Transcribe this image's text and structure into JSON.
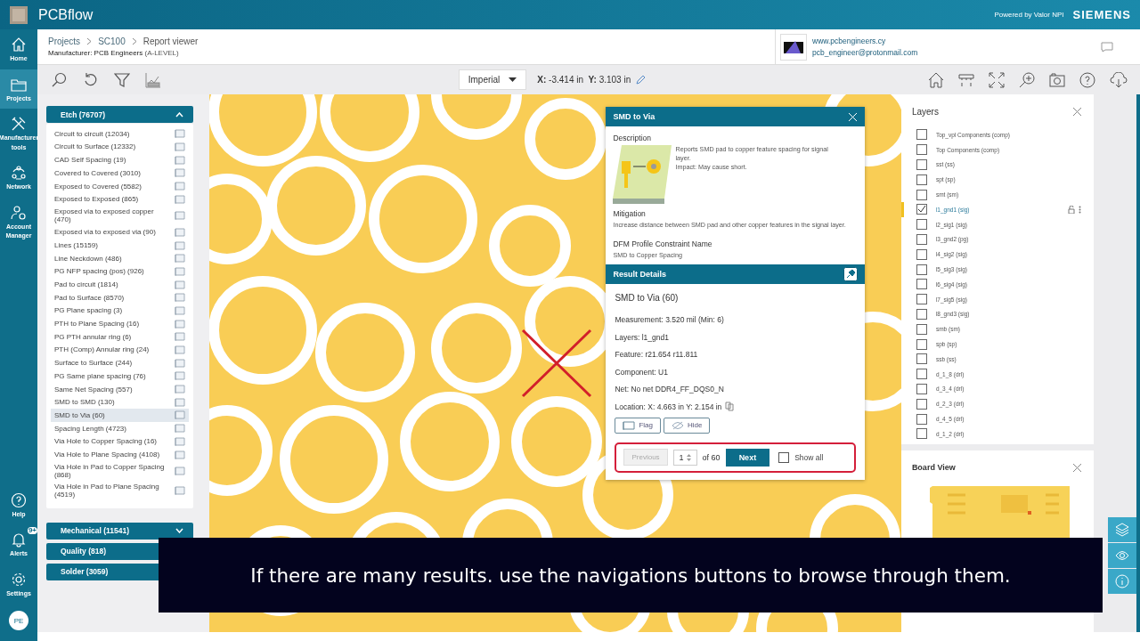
{
  "app": {
    "name": "PCBflow",
    "powered_by": "Powered by Valor NPI",
    "brand": "SIEMENS"
  },
  "nav": [
    {
      "label": "Home",
      "kind": "home",
      "selected": false
    },
    {
      "label": "Projects",
      "kind": "projects",
      "selected": true
    },
    {
      "label": "Manufacturer tools",
      "kind": "tools",
      "selected": false
    },
    {
      "label": "Network",
      "kind": "network",
      "selected": false
    },
    {
      "label": "Account Manager",
      "kind": "account",
      "selected": false
    }
  ],
  "nav_bottom": [
    {
      "label": "Help",
      "kind": "help"
    },
    {
      "label": "Alerts",
      "kind": "alerts",
      "badge": "9+"
    },
    {
      "label": "Settings",
      "kind": "settings"
    }
  ],
  "avatar": "PE",
  "breadcrumb": [
    "Projects",
    "SC100",
    "Report viewer"
  ],
  "manufacturer": {
    "label": "Manufacturer: PCB Engineers",
    "level": "(A-LEVEL)"
  },
  "contact": {
    "website": "www.pcbengineers.cy",
    "email": "pcb_engineer@protonmail.com"
  },
  "toolbar": {
    "units": "Imperial",
    "x_label": "X:",
    "x_value": "-3.414 in",
    "y_label": "Y:",
    "y_value": "3.103 in"
  },
  "categories": [
    {
      "label": "Etch (76707)",
      "expanded": true,
      "items": [
        {
          "label": "Circuit to circuit (12034)",
          "selected": false
        },
        {
          "label": "Circuit to Surface (12332)",
          "selected": false
        },
        {
          "label": "CAD Self Spacing (19)",
          "selected": false
        },
        {
          "label": "Covered to Covered (3010)",
          "selected": false
        },
        {
          "label": "Exposed to Covered (5582)",
          "selected": false
        },
        {
          "label": "Exposed to Exposed (865)",
          "selected": false
        },
        {
          "label": "Exposed via to exposed copper (470)",
          "selected": false
        },
        {
          "label": "Exposed via to exposed via (90)",
          "selected": false
        },
        {
          "label": "Lines (15159)",
          "selected": false
        },
        {
          "label": "Line Neckdown (486)",
          "selected": false
        },
        {
          "label": "PG NFP spacing (pos) (926)",
          "selected": false
        },
        {
          "label": "Pad to circuit (1814)",
          "selected": false
        },
        {
          "label": "Pad to Surface (8570)",
          "selected": false
        },
        {
          "label": "PG Plane spacing (3)",
          "selected": false
        },
        {
          "label": "PTH to Plane Spacing (16)",
          "selected": false
        },
        {
          "label": "PG PTH annular ring (6)",
          "selected": false
        },
        {
          "label": "PTH (Comp) Annular ring (24)",
          "selected": false
        },
        {
          "label": "Surface to Surface (244)",
          "selected": false
        },
        {
          "label": "PG Same plane spacing (76)",
          "selected": false
        },
        {
          "label": "Same Net Spacing (557)",
          "selected": false
        },
        {
          "label": "SMD to SMD (130)",
          "selected": false
        },
        {
          "label": "SMD to Via (60)",
          "selected": true
        },
        {
          "label": "Spacing Length (4723)",
          "selected": false
        },
        {
          "label": "Via Hole to Copper Spacing (16)",
          "selected": false
        },
        {
          "label": "Via Hole to Plane Spacing (4108)",
          "selected": false
        },
        {
          "label": "Via Hole in Pad to Copper Spacing (868)",
          "selected": false
        },
        {
          "label": "Via Hole in Pad to Plane Spacing (4519)",
          "selected": false
        }
      ]
    },
    {
      "label": "Mechanical (11541)",
      "expanded": false
    },
    {
      "label": "Quality (818)"
    },
    {
      "label": "Solder (3059)"
    }
  ],
  "popup": {
    "title": "SMD to Via",
    "description_heading": "Description",
    "description": [
      "Reports SMD pad to copper feature spacing for signal layer.",
      "Impact: May cause short."
    ],
    "mitigation_heading": "Mitigation",
    "mitigation": "Increase distance between SMD pad and other copper features in the signal layer.",
    "constraint_heading": "DFM Profile Constraint Name",
    "constraint": "SMD to Copper Spacing",
    "result_heading": "Result Details",
    "result_title": "SMD to Via (60)",
    "fields": [
      {
        "label": "Measurement:",
        "value": "3.520 mil  (Min: 6)"
      },
      {
        "label": "Layers:",
        "value": "l1_gnd1"
      },
      {
        "label": "Feature:",
        "value": "r21.654 r11.811"
      },
      {
        "label": "Component:",
        "value": "U1"
      },
      {
        "label": "Net:",
        "value": "No net DDR4_FF_DQS0_N"
      },
      {
        "label": "Location:",
        "value": "X: 4.663 in Y: 2.154 in"
      }
    ],
    "actions": [
      {
        "label": "Flag",
        "kind": "flag"
      },
      {
        "label": "Hide",
        "kind": "hide"
      }
    ],
    "pager": {
      "previous": "Previous",
      "previous_disabled": true,
      "page": "1",
      "of": "of 60",
      "next": "Next",
      "show_all": "Show all",
      "show_all_checked": false
    }
  },
  "layers": {
    "title": "Layers",
    "items": [
      {
        "label": "Top_vpl Components (comp)",
        "checked": false,
        "selected": false
      },
      {
        "label": "Top Components (comp)",
        "checked": false,
        "selected": false
      },
      {
        "label": "sst (ss)",
        "checked": false,
        "selected": false
      },
      {
        "label": "spt (sp)",
        "checked": false,
        "selected": false
      },
      {
        "label": "smt (sm)",
        "checked": false,
        "selected": false
      },
      {
        "label": "l1_gnd1 (sig)",
        "checked": true,
        "selected": true
      },
      {
        "label": "l2_sig1 (sig)",
        "checked": false,
        "selected": false
      },
      {
        "label": "l3_gnd2 (pg)",
        "checked": false,
        "selected": false
      },
      {
        "label": "l4_sig2 (sig)",
        "checked": false,
        "selected": false
      },
      {
        "label": "l5_sig3 (sig)",
        "checked": false,
        "selected": false
      },
      {
        "label": "l6_sig4 (sig)",
        "checked": false,
        "selected": false
      },
      {
        "label": "l7_sig5 (sig)",
        "checked": false,
        "selected": false
      },
      {
        "label": "l8_gnd3 (sig)",
        "checked": false,
        "selected": false
      },
      {
        "label": "smb (sm)",
        "checked": false,
        "selected": false
      },
      {
        "label": "spb (sp)",
        "checked": false,
        "selected": false
      },
      {
        "label": "ssb (ss)",
        "checked": false,
        "selected": false
      },
      {
        "label": "d_1_8 (drl)",
        "checked": false,
        "selected": false
      },
      {
        "label": "d_3_4 (drl)",
        "checked": false,
        "selected": false
      },
      {
        "label": "d_2_3 (drl)",
        "checked": false,
        "selected": false
      },
      {
        "label": "d_4_5 (drl)",
        "checked": false,
        "selected": false
      },
      {
        "label": "d_1_2 (drl)",
        "checked": false,
        "selected": false
      }
    ]
  },
  "board_view": {
    "title": "Board View"
  },
  "side_tools": [
    {
      "kind": "layers"
    },
    {
      "kind": "eye"
    },
    {
      "kind": "info"
    }
  ],
  "subtitle": "If there are many results. use the navigations buttons to browse through them."
}
